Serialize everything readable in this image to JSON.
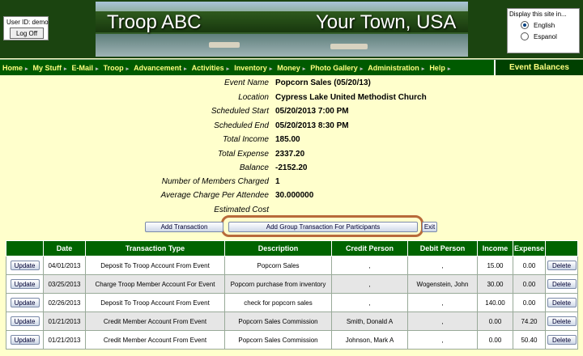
{
  "user": {
    "id_text": "User ID:  demo",
    "logoff_label": "Log Off"
  },
  "banner": {
    "title_left": "Troop ABC",
    "title_right": "Your Town, USA"
  },
  "language": {
    "prompt": "Display this site in...",
    "options": [
      {
        "label": "English",
        "selected": true
      },
      {
        "label": "Espanol",
        "selected": false
      }
    ]
  },
  "nav": {
    "items": [
      "Home",
      "My Stuff",
      "E-Mail",
      "Troop",
      "Advancement",
      "Activities",
      "Inventory",
      "Money",
      "Photo Gallery",
      "Administration",
      "Help"
    ],
    "page_title": "Event Balances"
  },
  "details": [
    {
      "label": "Event Name",
      "value": "Popcorn Sales (05/20/13)"
    },
    {
      "label": "Location",
      "value": "Cypress Lake United Methodist Church"
    },
    {
      "label": "Scheduled Start",
      "value": "05/20/2013 7:00 PM"
    },
    {
      "label": "Scheduled End",
      "value": "05/20/2013 8:30 PM"
    },
    {
      "label": "Total Income",
      "value": "185.00"
    },
    {
      "label": "Total Expense",
      "value": "2337.20"
    },
    {
      "label": "Balance",
      "value": "-2152.20"
    },
    {
      "label": "Number of Members Charged",
      "value": "1"
    },
    {
      "label": "Average Charge Per Attendee",
      "value": "30.000000"
    },
    {
      "label": "Estimated Cost",
      "value": ""
    }
  ],
  "actions": {
    "add_transaction": "Add Transaction",
    "add_group": "Add Group Transaction For Participants",
    "exit": "Exit"
  },
  "table": {
    "headers": [
      "",
      "Date",
      "Transaction Type",
      "Description",
      "Credit Person",
      "Debit Person",
      "Income",
      "Expense",
      ""
    ],
    "update_label": "Update",
    "delete_label": "Delete",
    "rows": [
      {
        "date": "04/01/2013",
        "type": "Deposit To Troop Account From Event",
        "desc": "Popcorn Sales",
        "credit": ",",
        "debit": ",",
        "income": "15.00",
        "expense": "0.00"
      },
      {
        "date": "03/25/2013",
        "type": "Charge Troop Member Account For Event",
        "desc": "Popcorn purchase from inventory",
        "credit": ",",
        "debit": "Wogenstein, John",
        "income": "30.00",
        "expense": "0.00"
      },
      {
        "date": "02/26/2013",
        "type": "Deposit To Troop Account From Event",
        "desc": "check for popcorn sales",
        "credit": ",",
        "debit": ",",
        "income": "140.00",
        "expense": "0.00"
      },
      {
        "date": "01/21/2013",
        "type": "Credit Member Account From Event",
        "desc": "Popcorn Sales Commission",
        "credit": "Smith, Donald A",
        "debit": ",",
        "income": "0.00",
        "expense": "74.20"
      },
      {
        "date": "01/21/2013",
        "type": "Credit Member Account From Event",
        "desc": "Popcorn Sales Commission",
        "credit": "Johnson, Mark A",
        "debit": ",",
        "income": "0.00",
        "expense": "50.40"
      }
    ]
  }
}
